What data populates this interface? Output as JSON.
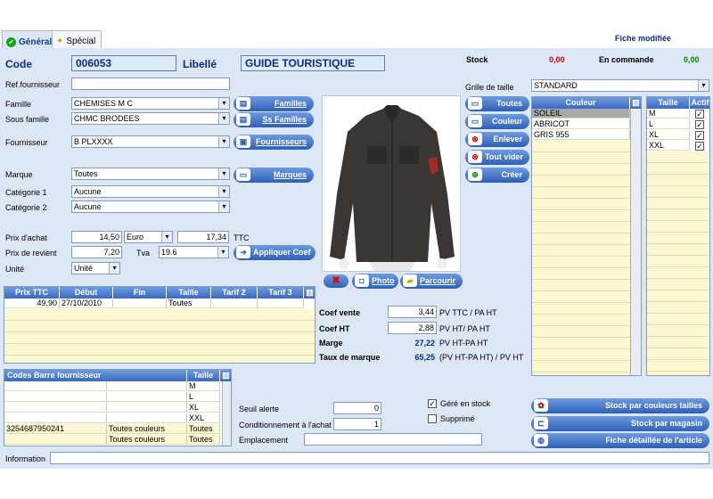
{
  "tabs": [
    {
      "label": "Général",
      "active": true
    },
    {
      "label": "Spécial",
      "active": false
    }
  ],
  "status": {
    "modified": "Fiche modifiée"
  },
  "header": {
    "code_label": "Code",
    "code_value": "006053",
    "libelle_label": "Libellé",
    "libelle_value": "GUIDE TOURISTIQUE",
    "stock_label": "Stock",
    "stock_value": "0,00",
    "commande_label": "En commande",
    "commande_value": "0,00"
  },
  "form": {
    "ref_label": "Ref.fournisseur",
    "ref_value": "",
    "famille_label": "Famille",
    "famille_value": "CHEMISES M C",
    "sousfamille_label": "Sous famille",
    "sousfamille_value": "CHMC BRODEES",
    "fournisseur_label": "Fournisseur",
    "fournisseur_value": "B PLXXXX",
    "marque_label": "Marque",
    "marque_value": "Toutes",
    "cat1_label": "Catégorie 1",
    "cat1_value": "Aucune",
    "cat2_label": "Catégorie 2",
    "cat2_value": "Aucune",
    "prixachat_label": "Prix d'achat",
    "prixachat_value": "14,50",
    "devise_value": "Euro",
    "ttc_value": "17,34",
    "ttc_label": "TTC",
    "prixrevient_label": "Prix de revient",
    "prixrevient_value": "7,20",
    "tva_label": "Tva",
    "tva_value": "19.6",
    "unite_label": "Unité",
    "unite_value": "Unité"
  },
  "buttons": {
    "familles": "Familles",
    "ssfamilles": "Ss Familles",
    "fournisseurs": "Fournisseurs",
    "marques": "Marques",
    "appliquer": "Appliquer Coef",
    "photo": "Photo",
    "parcourir": "Parcourir",
    "toutes": "Toutes",
    "couleur": "Couleur",
    "enlever": "Enlever",
    "toutvider": "Tout vider",
    "creer": "Créer",
    "stockcouleurs": "Stock par couleurs tailles",
    "stockmagasin": "Stock par magasin",
    "fiche": "Fiche détaillée de l'article"
  },
  "price_table": {
    "headers": [
      "Prix TTC",
      "Début",
      "Fin",
      "Taille",
      "Tarif 2",
      "Tarif 3"
    ],
    "rows": [
      [
        "49,90",
        "27/10/2010",
        "",
        "Toutes",
        "",
        ""
      ]
    ]
  },
  "coef": {
    "vente_label": "Coef vente",
    "vente_value": "3,44",
    "vente_desc": "PV TTC / PA HT",
    "ht_label": "Coef HT",
    "ht_value": "2,88",
    "ht_desc": "PV HT/ PA HT",
    "marge_label": "Marge",
    "marge_value": "27,22",
    "marge_desc": "PV HT-PA HT",
    "taux_label": "Taux de marque",
    "taux_value": "65,25",
    "taux_desc": "(PV HT-PA HT) / PV HT"
  },
  "barcode_table": {
    "headers": [
      "Codes Barre fournisseur",
      "Taille"
    ],
    "rows": [
      [
        "",
        "",
        "M"
      ],
      [
        "",
        "",
        "L"
      ],
      [
        "",
        "",
        "XL"
      ],
      [
        "",
        "",
        "XXL"
      ],
      [
        "3254687950241",
        "Toutes couleurs",
        "Toutes"
      ],
      [
        "",
        "Toutes couleurs",
        "Toutes"
      ]
    ]
  },
  "misc": {
    "seuil_label": "Seuil alerte",
    "seuil_value": "0",
    "cond_label": "Conditionnement à l'achat",
    "cond_value": "1",
    "emplacement_label": "Emplacement",
    "emplacement_value": "",
    "gere_label": "Géré en stock",
    "gere_checked": true,
    "supprime_label": "Supprimé",
    "supprime_checked": false,
    "info_label": "Information",
    "info_value": ""
  },
  "grille": {
    "label": "Grille de taille",
    "value": "STANDARD",
    "couleur_header": "Couleur",
    "taille_header": "Taille",
    "actif_header": "Actif",
    "couleurs": [
      "SOLEIL",
      "ABRICOT",
      "GRIS 955"
    ],
    "tailles": [
      {
        "name": "M",
        "active": true
      },
      {
        "name": "L",
        "active": true
      },
      {
        "name": "XL",
        "active": true
      },
      {
        "name": "XXL",
        "active": true
      }
    ]
  },
  "colors": {
    "accent": "#0a2d8c",
    "red": "#d40000",
    "green": "#0a8a00",
    "panel": "#dce6f4"
  }
}
